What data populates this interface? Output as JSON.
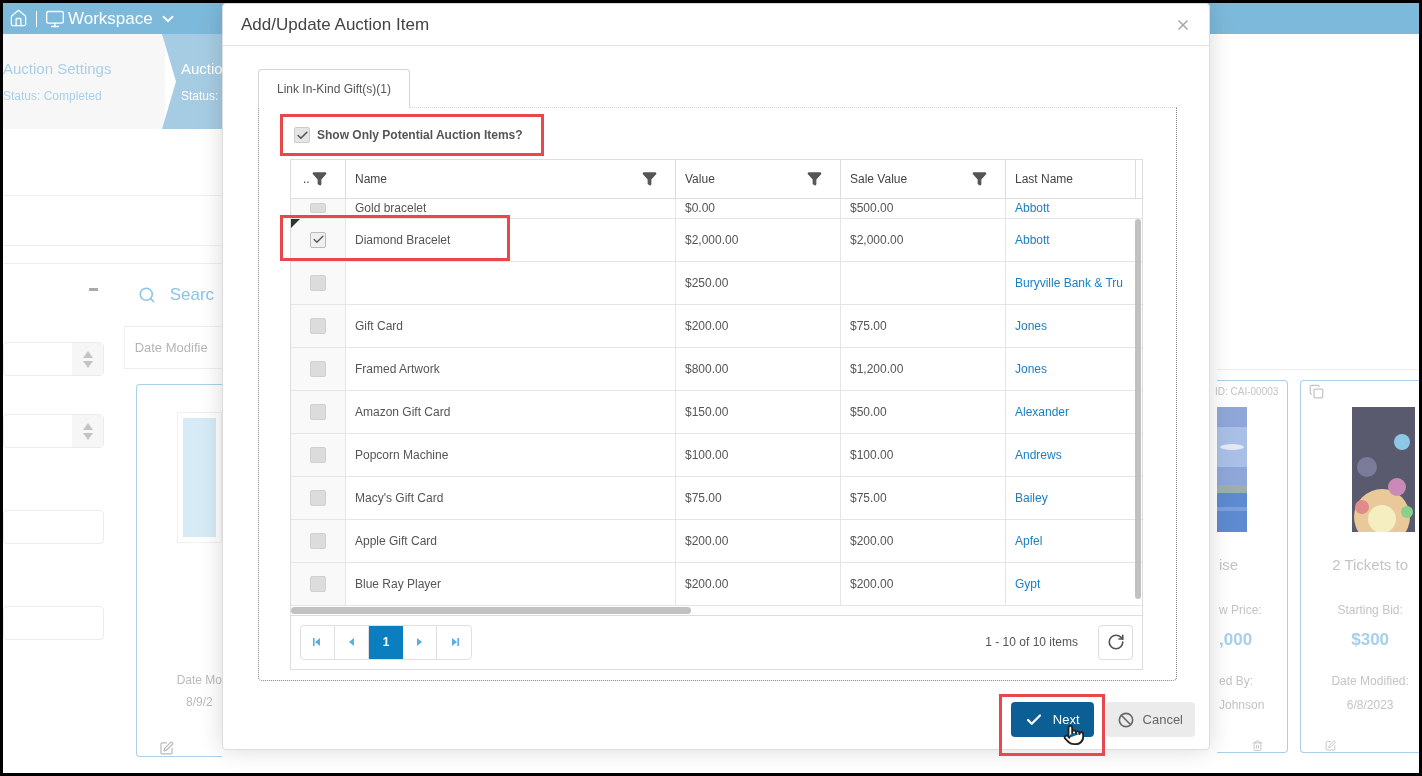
{
  "app": {
    "nav": {
      "workspace": "Workspace"
    },
    "steps": [
      {
        "title": "Auction Settings",
        "status": "Status: Completed",
        "selected": false
      },
      {
        "title": "Auctio",
        "status": "Status:",
        "selected": true
      }
    ],
    "search": {
      "placeholder": "Searc"
    },
    "sort_label": "Date Modifie",
    "left_card": {
      "date_label": "Date Mo",
      "date": "8/9/2"
    },
    "right_cards": [
      {
        "id": "ID: CAI-00003",
        "title": "ise",
        "price_label": "w Price:",
        "price": ",000",
        "by_label": "ed By:",
        "by": "Johnson"
      },
      {
        "title": "2 Tickets to",
        "price_label": "Starting Bid:",
        "price": "$300",
        "by_label": "Date Modified:",
        "by": "6/8/2023"
      }
    ]
  },
  "dialog": {
    "title": "Add/Update Auction Item",
    "tabs": [
      {
        "label": "Link In-Kind Gift(s)(1)",
        "selected": true
      }
    ],
    "filter": {
      "label": "Show Only Potential Auction Items?",
      "checked": true
    },
    "columns": [
      "..",
      "Name",
      "Value",
      "Sale Value",
      "Last Name"
    ],
    "rows": [
      {
        "name": "Gold bracelet",
        "value": "$0.00",
        "sale_value": "$500.00",
        "last_name": "Abbott",
        "checked": false,
        "current": false,
        "partial": true
      },
      {
        "name": "Diamond Bracelet",
        "value": "$2,000.00",
        "sale_value": "$2,000.00",
        "last_name": "Abbott",
        "checked": true,
        "current": true,
        "partial": false
      },
      {
        "name": "",
        "value": "$250.00",
        "sale_value": "",
        "last_name": "Buryville Bank & Tru",
        "checked": false,
        "current": false,
        "partial": false
      },
      {
        "name": "Gift Card",
        "value": "$200.00",
        "sale_value": "$75.00",
        "last_name": "Jones",
        "checked": false,
        "current": false,
        "partial": false
      },
      {
        "name": "Framed Artwork",
        "value": "$800.00",
        "sale_value": "$1,200.00",
        "last_name": "Jones",
        "checked": false,
        "current": false,
        "partial": false
      },
      {
        "name": "Amazon Gift Card",
        "value": "$150.00",
        "sale_value": "$50.00",
        "last_name": "Alexander",
        "checked": false,
        "current": false,
        "partial": false
      },
      {
        "name": "Popcorn Machine",
        "value": "$100.00",
        "sale_value": "$100.00",
        "last_name": "Andrews",
        "checked": false,
        "current": false,
        "partial": false
      },
      {
        "name": "Macy's Gift Card",
        "value": "$75.00",
        "sale_value": "$75.00",
        "last_name": "Bailey",
        "checked": false,
        "current": false,
        "partial": false
      },
      {
        "name": "Apple Gift Card",
        "value": "$200.00",
        "sale_value": "$200.00",
        "last_name": "Apfel",
        "checked": false,
        "current": false,
        "partial": false
      },
      {
        "name": "Blue Ray Player",
        "value": "$200.00",
        "sale_value": "$200.00",
        "last_name": "Gypt",
        "checked": false,
        "current": false,
        "partial": false
      }
    ],
    "pager": {
      "pages": [
        {
          "label": "1",
          "selected": true
        }
      ],
      "summary": "1 - 10 of 10 items"
    },
    "buttons": [
      {
        "kind": "primary",
        "label": "Next"
      },
      {
        "kind": "secondary",
        "label": "Cancel"
      }
    ]
  }
}
